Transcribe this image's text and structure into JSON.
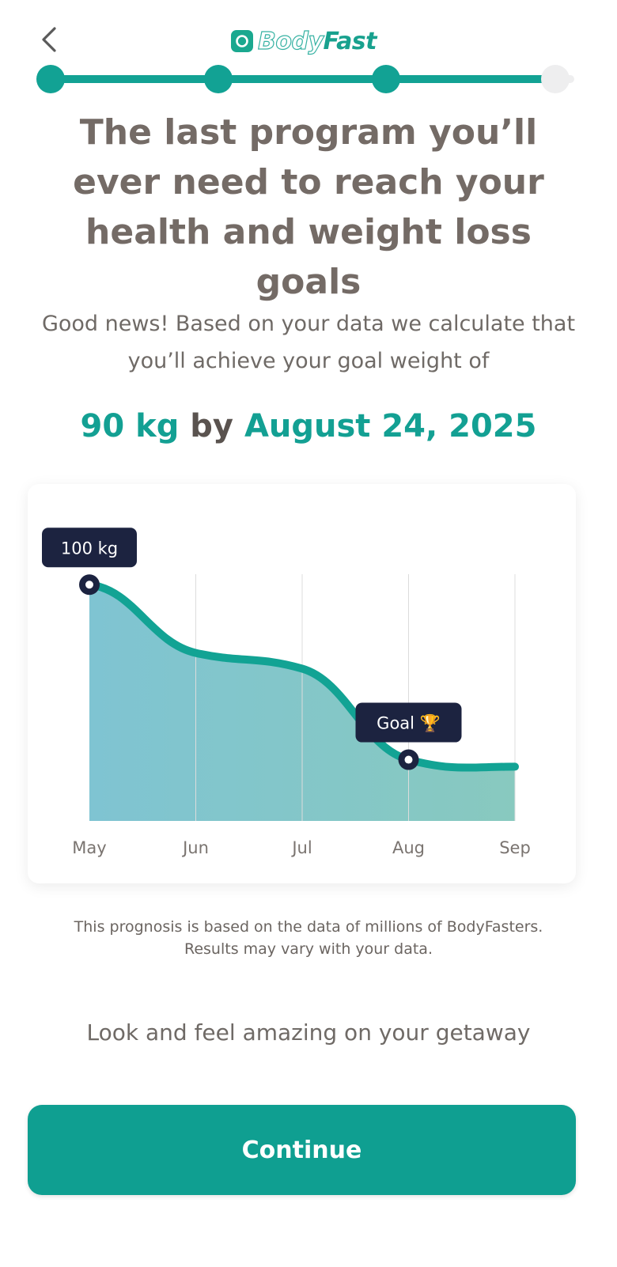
{
  "header": {
    "back_icon": "chevron-left-icon",
    "logo_icon": "bodyfast-logo-icon",
    "logo_part1": "Body",
    "logo_part2": "Fast",
    "progress": {
      "total_steps": 4,
      "completed_steps": 3,
      "fill_fraction": 0.97
    }
  },
  "title": "The last program you’ll ever need to reach your health and weight loss goals",
  "subtitle": "Good news! Based on your data we calculate that you’ll achieve your goal weight of",
  "goal": {
    "weight": "90 kg",
    "connector": "by",
    "date": "August 24, 2025"
  },
  "chart_data": {
    "type": "area",
    "title": "",
    "xlabel": "",
    "ylabel": "",
    "categories": [
      "May",
      "Jun",
      "Jul",
      "Aug",
      "Sep"
    ],
    "x": [
      0,
      1,
      2,
      3,
      4
    ],
    "values": [
      100,
      96.1,
      95.2,
      90,
      89.6
    ],
    "grid": "vertical",
    "annotations": [
      {
        "label": "100 kg",
        "x_index": 0,
        "value": 100
      },
      {
        "label": "Goal 🏆",
        "x_index": 3,
        "value": 90
      }
    ],
    "colors": {
      "line": "#12a394",
      "fill_start": "#7fc4d2",
      "fill_end": "#88c9bf",
      "marker": "#1c2340",
      "tooltip_bg": "#1c2340"
    }
  },
  "note": {
    "line1": "This prognosis is based on the data of millions of BodyFasters.",
    "line2": "Results may vary with your data."
  },
  "tagline": "Look and feel amazing on your getaway",
  "continue_label": "Continue",
  "colors": {
    "accent": "#0f9f91",
    "text": "#746b66"
  }
}
